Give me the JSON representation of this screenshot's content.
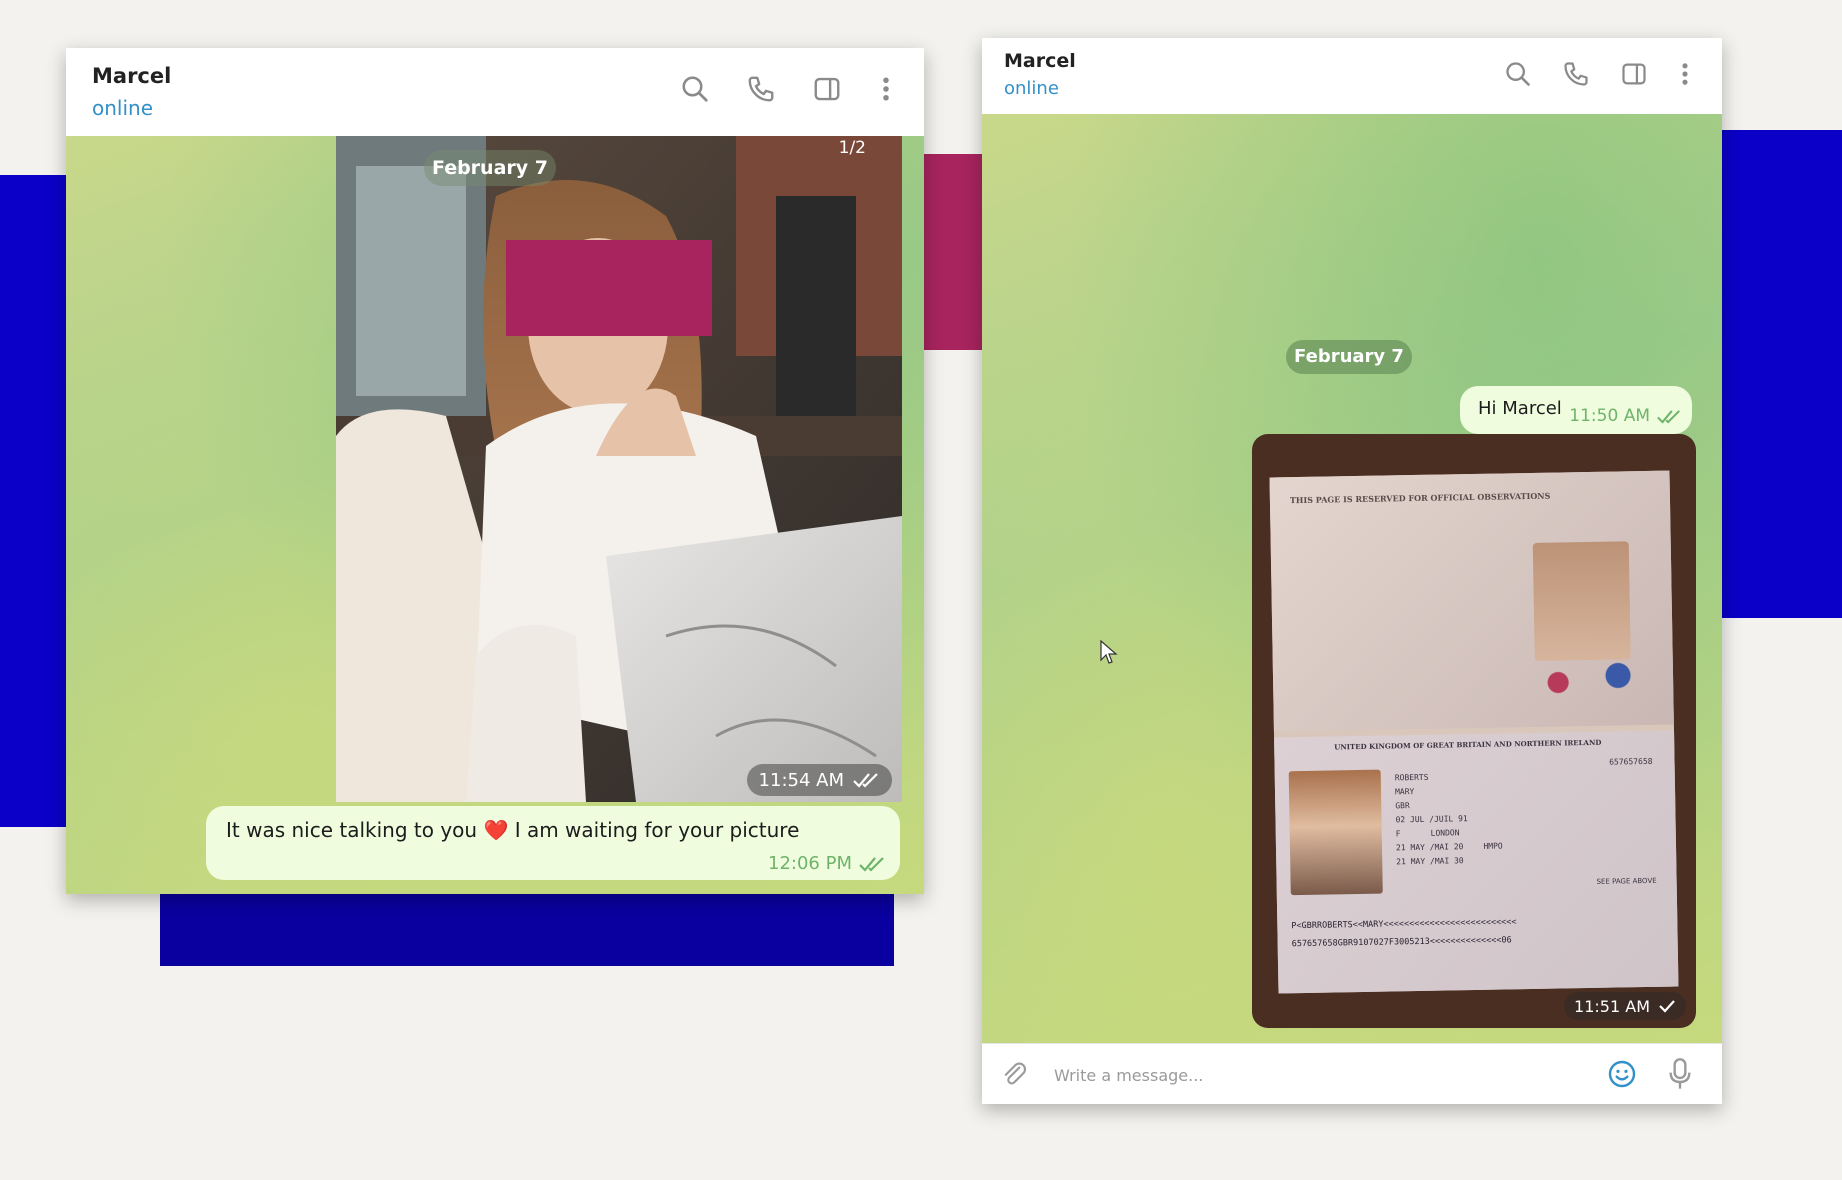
{
  "colors": {
    "accent": "#3390c8",
    "bubble": "#effdde",
    "check": "#6fb36a",
    "deco_blue": "#0a00c8",
    "deco_magenta": "#a8245f"
  },
  "left_window": {
    "contact_name": "Marcel",
    "status": "online",
    "header_icons": [
      "search-icon",
      "phone-icon",
      "sidebar-icon",
      "more-icon"
    ],
    "date_label": "February 7",
    "photo_counter": "1/2",
    "photo_time": "11:54 AM",
    "message_text": "It was nice talking to you ❤️ I am waiting for your picture",
    "message_time": "12:06 PM"
  },
  "right_window": {
    "contact_name": "Marcel",
    "status": "online",
    "header_icons": [
      "search-icon",
      "phone-icon",
      "sidebar-icon",
      "more-icon"
    ],
    "date_label": "February 7",
    "message_text": "Hi Marcel",
    "message_time": "11:50 AM",
    "photo_time": "11:51 AM",
    "passport": {
      "top_notice": "THIS PAGE IS RESERVED FOR OFFICIAL OBSERVATIONS",
      "issuer": "UNITED KINGDOM OF GREAT BRITAIN AND NORTHERN IRELAND",
      "number": "657657658",
      "surname": "ROBERTS",
      "given_name": "MARY",
      "nationality": "GBR",
      "dob": "02 JUL /JUIL 91",
      "sex": "F",
      "pob": "LONDON",
      "issue": "21 MAY /MAI 20",
      "authority": "HMPO",
      "expiry": "21 MAY /MAI 30",
      "see_page": "SEE PAGE ABOVE",
      "mrz1": "P<GBRROBERTS<<MARY<<<<<<<<<<<<<<<<<<<<<<<<<<",
      "mrz2": "657657658GBR9107027F3005213<<<<<<<<<<<<<<06"
    },
    "composer_placeholder": "Write a message..."
  }
}
